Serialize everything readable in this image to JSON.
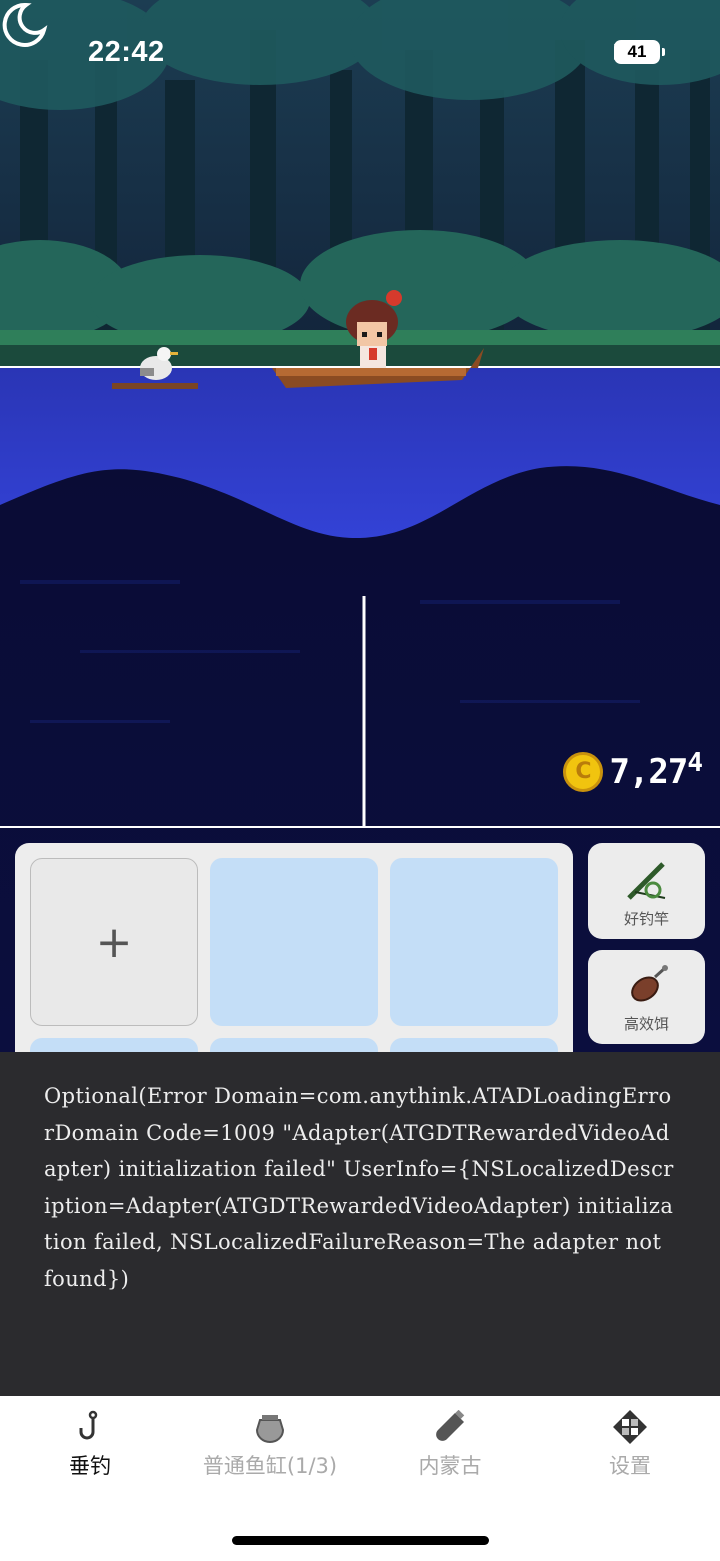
{
  "status_bar": {
    "time": "22:42",
    "battery": "41"
  },
  "hud": {
    "coin_amount": "7,27",
    "coin_amount_small": "4",
    "coin_symbol": "C"
  },
  "side_buttons": [
    {
      "label": "好钓竿",
      "icon": "fishing-rod-icon"
    },
    {
      "label": "高效饵",
      "icon": "bait-icon"
    }
  ],
  "slots": {
    "add_symbol": "+"
  },
  "error_message": "Optional(Error Domain=com.anythink.ATADLoadingErrorDomain Code=1009 \"Adapter(ATGDTRewardedVideoAdapter) initialization failed\" UserInfo={NSLocalizedDescription=Adapter(ATGDTRewardedVideoAdapter) initialization failed, NSLocalizedFailureReason=The adapter not found})",
  "tabs": [
    {
      "label": "垂钓",
      "icon": "hook-icon",
      "active": true
    },
    {
      "label": "普通鱼缸(1/3)",
      "icon": "fish-tank-icon",
      "active": false
    },
    {
      "label": "内蒙古",
      "icon": "bottle-icon",
      "active": false
    },
    {
      "label": "设置",
      "icon": "settings-icon",
      "active": false
    }
  ],
  "colors": {
    "accent_blue": "#2f3fcf",
    "slot_blue": "#c4def7",
    "coin": "#f1c40f"
  }
}
